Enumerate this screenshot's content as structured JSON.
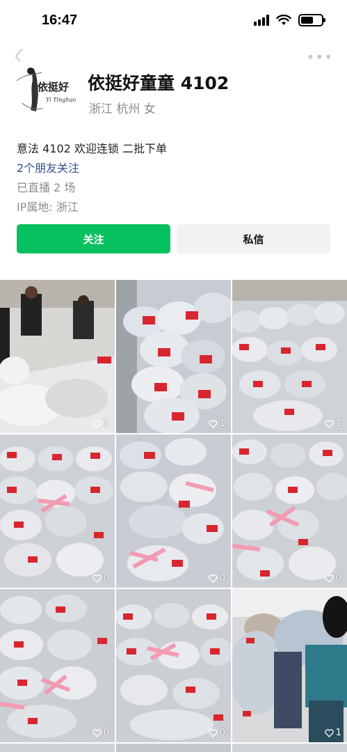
{
  "status_bar": {
    "time": "16:47"
  },
  "profile": {
    "avatar_text": "依挺好",
    "avatar_subtext": "Yi Tinghao",
    "name": "依挺好童童 4102",
    "region": "浙江 杭州  女"
  },
  "bio": {
    "line1": "意法 4102  欢迎连锁 二批下单",
    "friends": "2个朋友关注",
    "live": "已直播 2 场",
    "ip": "IP属地: 浙江"
  },
  "actions": {
    "follow_label": "关注",
    "message_label": "私信"
  },
  "posts": [
    {
      "likes": "1"
    },
    {
      "likes": "1"
    },
    {
      "likes": "1"
    },
    {
      "likes": "0"
    },
    {
      "likes": "0"
    },
    {
      "likes": "0"
    },
    {
      "likes": "0"
    },
    {
      "likes": "0"
    },
    {
      "likes": "1"
    }
  ],
  "colors": {
    "primary_green": "#07c160",
    "link_blue": "#2f4f8a",
    "muted_gray": "#8a8a8a"
  }
}
